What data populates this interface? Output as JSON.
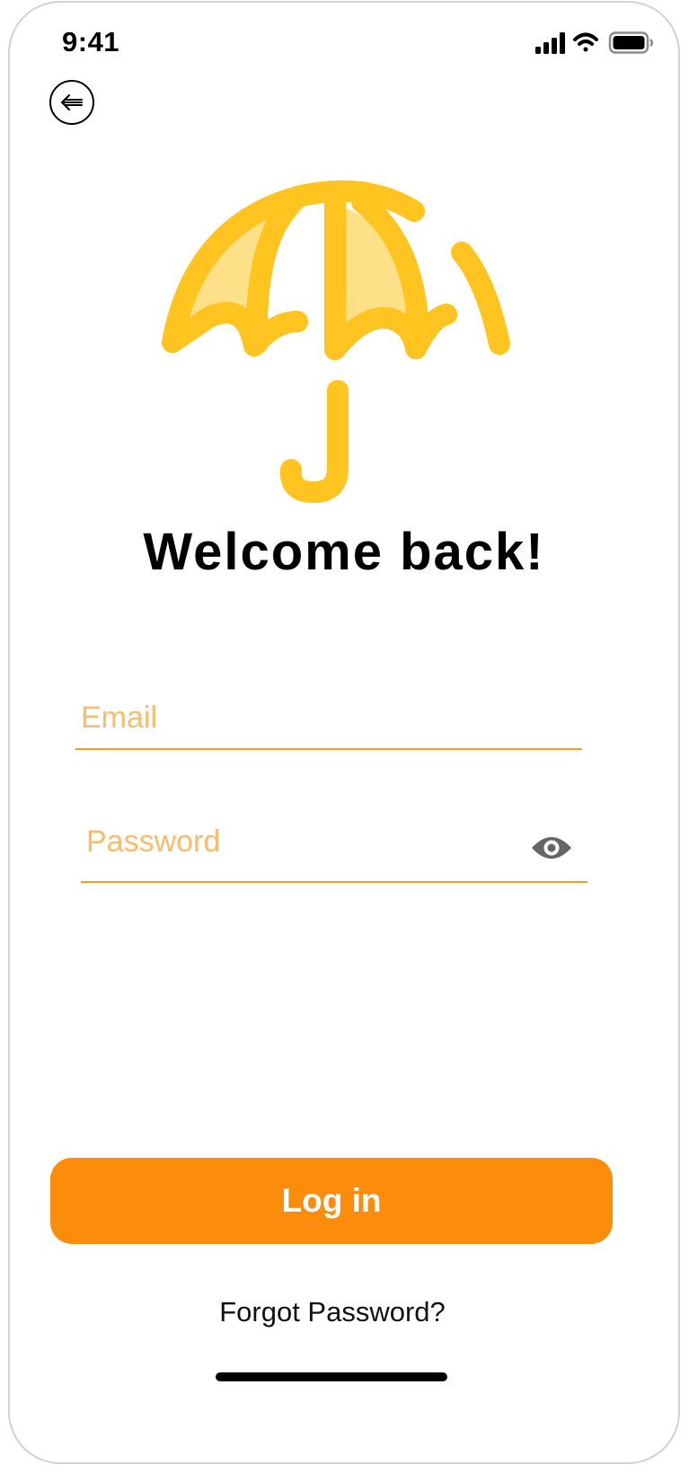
{
  "status_bar": {
    "time": "9:41",
    "icons": [
      "cellular-signal-icon",
      "wifi-icon",
      "battery-icon"
    ]
  },
  "header": {
    "back_icon": "arrow-left-icon"
  },
  "logo": {
    "icon": "umbrella-icon",
    "colors": {
      "stroke": "#ffc41f",
      "fill": "#fde088"
    }
  },
  "title": "Welcome back!",
  "form": {
    "email": {
      "placeholder": "Email",
      "value": ""
    },
    "password": {
      "placeholder": "Password",
      "value": "",
      "toggle_icon": "eye-icon"
    }
  },
  "actions": {
    "login_label": "Log in",
    "forgot_label": "Forgot Password?"
  },
  "colors": {
    "accent": "#fc8d0c",
    "field_line": "#fa9a1e",
    "placeholder": "#f9bb6c"
  }
}
